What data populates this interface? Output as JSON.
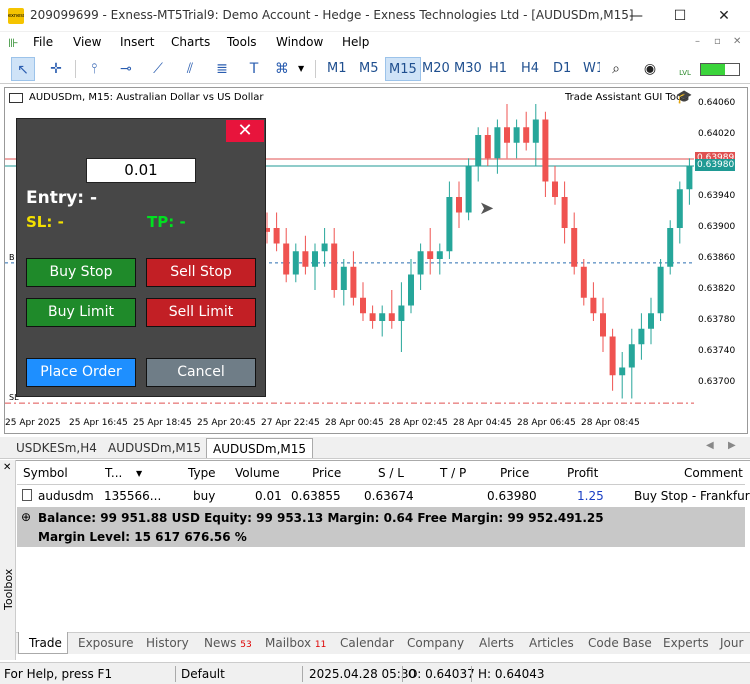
{
  "window": {
    "title": "209099699 - Exness-MT5Trial9: Demo Account - Hedge - Exness Technologies Ltd - [AUDUSDm,M15]",
    "logo_text": "exness"
  },
  "menu": [
    "File",
    "View",
    "Insert",
    "Charts",
    "Tools",
    "Window",
    "Help"
  ],
  "timeframes": [
    "M1",
    "M5",
    "M15",
    "M20",
    "M30",
    "H1",
    "H4",
    "D1",
    "W1"
  ],
  "active_timeframe": "M15",
  "toolbar_extra": {
    "lvl": "LVL"
  },
  "chart": {
    "symbol_label": "AUDUSDm, M15:  Australian Dollar vs US Dollar",
    "tool_label": "Trade Assistant GUI Tool",
    "price_labels": [
      "0.64060",
      "0.64020",
      "0.63980",
      "0.63940",
      "0.63900",
      "0.63860",
      "0.63820",
      "0.63780",
      "0.63740",
      "0.63700"
    ],
    "price_tag_red": "0.63989",
    "price_tag_teal": "0.63980",
    "time_labels": [
      "25 Apr 2025",
      "25 Apr 16:45",
      "25 Apr 18:45",
      "25 Apr 20:45",
      "27 Apr 22:45",
      "28 Apr 00:45",
      "28 Apr 02:45",
      "28 Apr 04:45",
      "28 Apr 06:45",
      "28 Apr 08:45"
    ],
    "left_marker_b": "B",
    "left_marker_sl": "SL",
    "colors": {
      "bull": "#26a69a",
      "bear": "#ef5350"
    }
  },
  "panel": {
    "close_icon": "✕",
    "lot_value": "0.01",
    "entry_label": "Entry: -",
    "sl_label": "SL: -",
    "tp_label": "TP: -",
    "buy_stop": "Buy Stop",
    "sell_stop": "Sell Stop",
    "buy_limit": "Buy Limit",
    "sell_limit": "Sell Limit",
    "place_order": "Place Order",
    "cancel": "Cancel"
  },
  "symbol_tabs": [
    "USDKESm,H4",
    "AUDUSDm,M15",
    "AUDUSDm,M15"
  ],
  "active_symbol_tab": 2,
  "trade_table": {
    "headers": [
      "Symbol",
      "T...",
      "Type",
      "Volume",
      "Price",
      "S / L",
      "T / P",
      "Price",
      "Profit",
      "Comment"
    ],
    "row": [
      "audusdm",
      "135566...",
      "buy",
      "0.01",
      "0.63855",
      "0.63674",
      "",
      "0.63980",
      "1.25",
      "Buy Stop - Frankfurt"
    ],
    "balance_line": "Balance: 99 951.88 USD  Equity: 99 953.13  Margin: 0.64  Free Margin: 99 952.49",
    "balance_profit": "1.25",
    "margin_level": "Margin Level: 15 617 676.56 %"
  },
  "toolbox_label": "Toolbox",
  "bottom_tabs": [
    {
      "label": "Trade",
      "badge": ""
    },
    {
      "label": "Exposure",
      "badge": ""
    },
    {
      "label": "History",
      "badge": ""
    },
    {
      "label": "News",
      "badge": "53"
    },
    {
      "label": "Mailbox",
      "badge": "11"
    },
    {
      "label": "Calendar",
      "badge": ""
    },
    {
      "label": "Company",
      "badge": ""
    },
    {
      "label": "Alerts",
      "badge": ""
    },
    {
      "label": "Articles",
      "badge": ""
    },
    {
      "label": "Code Base",
      "badge": ""
    },
    {
      "label": "Experts",
      "badge": ""
    },
    {
      "label": "Jour",
      "badge": ""
    }
  ],
  "status": {
    "help": "For Help, press F1",
    "profile": "Default",
    "datetime": "2025.04.28 05:30",
    "open": "O: 0.64037",
    "high": "H: 0.64043"
  }
}
